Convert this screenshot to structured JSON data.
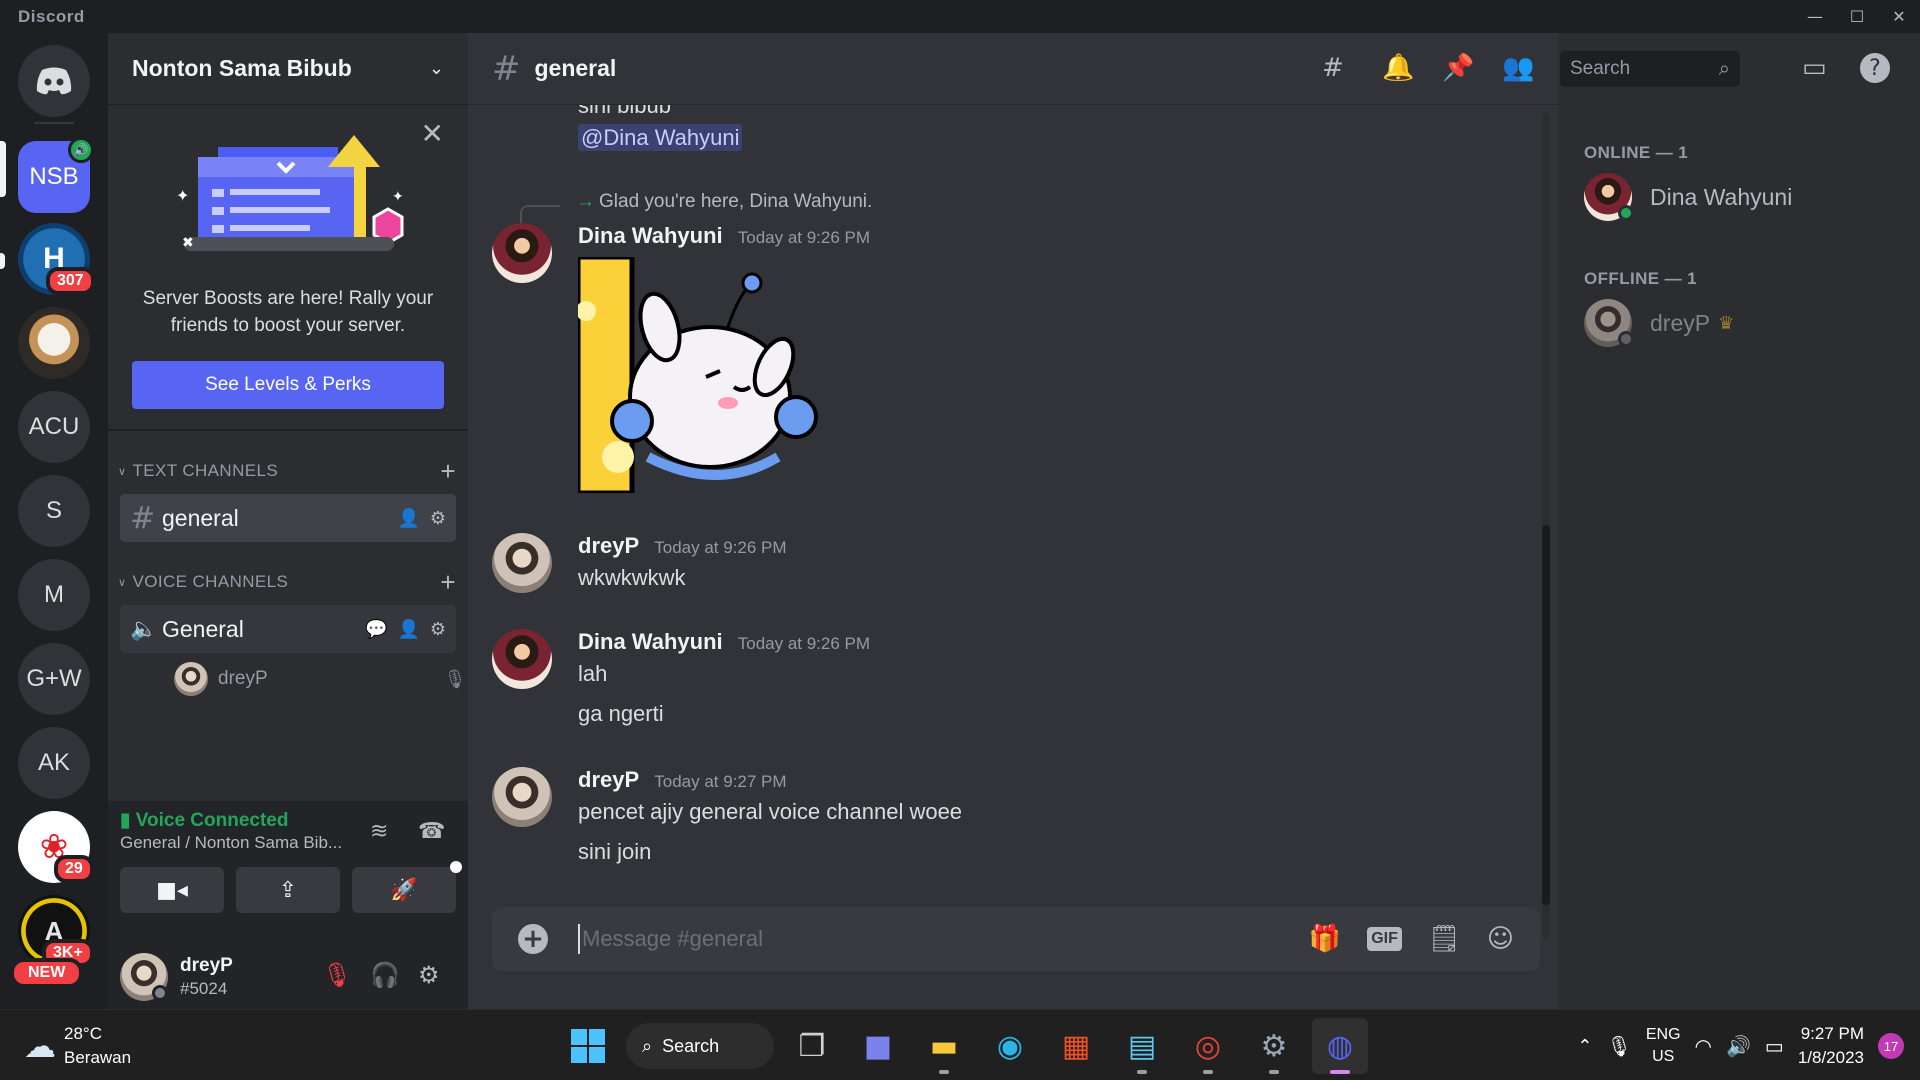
{
  "window": {
    "title": "Discord"
  },
  "servers": {
    "items": [
      {
        "label": "NSB",
        "icon": "speaker-icon"
      },
      {
        "label": "",
        "badge": "307"
      },
      {
        "label": ""
      },
      {
        "label": "ACU"
      },
      {
        "label": "S"
      },
      {
        "label": "M"
      },
      {
        "label": "G+W"
      },
      {
        "label": "AK"
      },
      {
        "label": "",
        "badge": "29"
      },
      {
        "label": "",
        "badge": "3K+",
        "badge2": "NEW"
      }
    ]
  },
  "sidebar": {
    "server_name": "Nonton Sama Bibub",
    "boost": {
      "text": "Server Boosts are here! Rally your friends to boost your server.",
      "button": "See Levels & Perks"
    },
    "text_category": "TEXT CHANNELS",
    "text_channel": "general",
    "voice_category": "VOICE CHANNELS",
    "voice_channel": "General",
    "voice_user": "dreyP"
  },
  "voice_panel": {
    "status": "Voice Connected",
    "location": "General / Nonton Sama Bib..."
  },
  "user_panel": {
    "username": "dreyP",
    "tag": "#5024"
  },
  "header": {
    "channel": "general",
    "search_placeholder": "Search"
  },
  "chat": {
    "partial_top": "sini bibub",
    "mention": "@Dina Wahyuni",
    "reply": "Glad you're here, Dina Wahyuni.",
    "messages": [
      {
        "author": "Dina Wahyuni",
        "time": "Today at 9:26 PM",
        "lines": []
      },
      {
        "author": "dreyP",
        "time": "Today at 9:26 PM",
        "lines": [
          "wkwkwkwk"
        ]
      },
      {
        "author": "Dina Wahyuni",
        "time": "Today at 9:26 PM",
        "lines": [
          "lah",
          "ga ngerti"
        ]
      },
      {
        "author": "dreyP",
        "time": "Today at 9:27 PM",
        "lines": [
          "pencet ajiy general voice channel woee",
          "sini join"
        ]
      }
    ],
    "composer_placeholder": "Message #general"
  },
  "members": {
    "online_header": "ONLINE — 1",
    "offline_header": "OFFLINE — 1",
    "online": [
      {
        "name": "Dina Wahyuni"
      }
    ],
    "offline": [
      {
        "name": "dreyP",
        "crown": "crown-icon"
      }
    ]
  },
  "taskbar": {
    "weather_temp": "28°C",
    "weather_desc": "Berawan",
    "search": "Search",
    "lang1": "ENG",
    "lang2": "US",
    "time": "9:27 PM",
    "date": "1/8/2023",
    "notifications": "17"
  },
  "colors": {
    "accent": "#5865f2",
    "online": "#23a55a",
    "badge": "#f23f43",
    "voice_connected": "#23a55a"
  }
}
